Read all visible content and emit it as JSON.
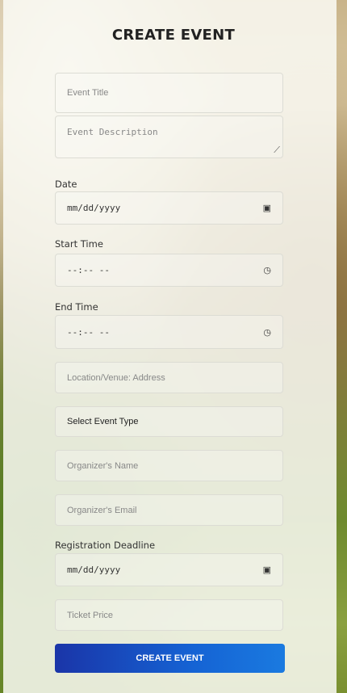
{
  "title": "CREATE EVENT",
  "fields": {
    "event_title": "Event Title",
    "event_description": "Event Description",
    "date_label": "Date",
    "date_placeholder": "mm/dd/yyyy",
    "start_time_label": "Start Time",
    "start_time_placeholder": "--:-- --",
    "end_time_label": "End Time",
    "end_time_placeholder": "--:-- --",
    "location": "Location/Venue: Address",
    "event_type": "Select Event Type",
    "organizer_name": "Organizer's Name",
    "organizer_email": "Organizer's Email",
    "deadline_label": "Registration Deadline",
    "deadline_placeholder": "mm/dd/yyyy",
    "ticket_price": "Ticket Price"
  },
  "submit_label": "CREATE EVENT",
  "colors": {
    "button_start": "#1a35a8",
    "button_end": "#1a7ae0"
  }
}
